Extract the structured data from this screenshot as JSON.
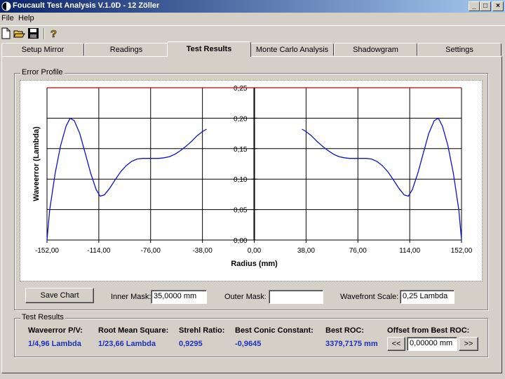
{
  "window": {
    "title": "Foucault Test Analysis V.1.0D - 12 Zöller",
    "minimize": "_",
    "maximize": "□",
    "close": "×"
  },
  "menu": [
    "File",
    "Help"
  ],
  "toolbar": {
    "icons": [
      "new-file-icon",
      "open-folder-icon",
      "save-disk-icon",
      "help-question-icon"
    ]
  },
  "tabs": [
    {
      "label": "Setup Mirror",
      "active": false
    },
    {
      "label": "Readings",
      "active": false
    },
    {
      "label": "Test Results",
      "active": true
    },
    {
      "label": "Monte Carlo Analysis",
      "active": false
    },
    {
      "label": "Shadowgram",
      "active": false
    },
    {
      "label": "Settings",
      "active": false
    }
  ],
  "error_profile": {
    "group_label": "Error Profile",
    "save_chart_label": "Save Chart",
    "inner_mask_label": "Inner Mask:",
    "inner_mask_value": "35,0000 mm",
    "outer_mask_label": "Outer Mask:",
    "outer_mask_value": "",
    "wavefront_scale_label": "Wavefront Scale:",
    "wavefront_scale_value": "0,25 Lambda"
  },
  "chart_data": {
    "type": "line",
    "xlabel": "Radius (mm)",
    "ylabel": "Waveerror (Lambda)",
    "xlim": [
      -152,
      152
    ],
    "ylim": [
      0,
      0.25
    ],
    "x_ticks": [
      "-152,00",
      "-114,00",
      "-76,00",
      "-38,00",
      "0,00",
      "38,00",
      "76,00",
      "114,00",
      "152,00"
    ],
    "y_ticks": [
      "0,00",
      "0,05",
      "0,10",
      "0,15",
      "0,20",
      "0,25"
    ],
    "grid": true,
    "reference_line": {
      "y": 0.25,
      "color": "#cc0000"
    },
    "series": [
      {
        "color": "#1010d0",
        "x": [
          -152,
          -150,
          -146,
          -142,
          -138,
          -135,
          -132,
          -128,
          -124,
          -120,
          -116,
          -113,
          -110,
          -106,
          -102,
          -98,
          -94,
          -90,
          -86,
          -82,
          -78,
          -74,
          -70,
          -66,
          -62,
          -58,
          -54,
          -50,
          -46,
          -42,
          -38,
          -35
        ],
        "y": [
          0.0,
          0.05,
          0.11,
          0.155,
          0.187,
          0.2,
          0.196,
          0.175,
          0.143,
          0.11,
          0.083,
          0.072,
          0.074,
          0.085,
          0.099,
          0.112,
          0.122,
          0.129,
          0.133,
          0.134,
          0.134,
          0.134,
          0.134,
          0.135,
          0.137,
          0.141,
          0.147,
          0.154,
          0.162,
          0.171,
          0.178,
          0.182
        ]
      },
      {
        "color": "#1010d0",
        "x": [
          35,
          38,
          42,
          46,
          50,
          54,
          58,
          62,
          66,
          70,
          74,
          78,
          82,
          86,
          90,
          94,
          98,
          102,
          106,
          110,
          113,
          116,
          120,
          124,
          128,
          132,
          135,
          138,
          142,
          146,
          150,
          152
        ],
        "y": [
          0.182,
          0.178,
          0.171,
          0.162,
          0.154,
          0.147,
          0.141,
          0.137,
          0.135,
          0.134,
          0.134,
          0.134,
          0.134,
          0.133,
          0.129,
          0.122,
          0.112,
          0.099,
          0.085,
          0.074,
          0.072,
          0.083,
          0.11,
          0.143,
          0.175,
          0.196,
          0.2,
          0.187,
          0.155,
          0.11,
          0.05,
          0.0
        ]
      }
    ]
  },
  "test_results": {
    "group_label": "Test Results",
    "items": [
      {
        "label": "Waveerror P/V:",
        "value": "1/4,96 Lambda"
      },
      {
        "label": "Root Mean Square:",
        "value": "1/23,66 Lambda"
      },
      {
        "label": "Strehl Ratio:",
        "value": "0,9295"
      },
      {
        "label": "Best Conic Constant:",
        "value": "-0,9645"
      },
      {
        "label": "Best ROC:",
        "value": "3379,7175 mm"
      }
    ],
    "offset_label": "Offset from Best ROC:",
    "offset_value": "0,00000 mm",
    "prev_label": "<<",
    "next_label": ">>"
  }
}
